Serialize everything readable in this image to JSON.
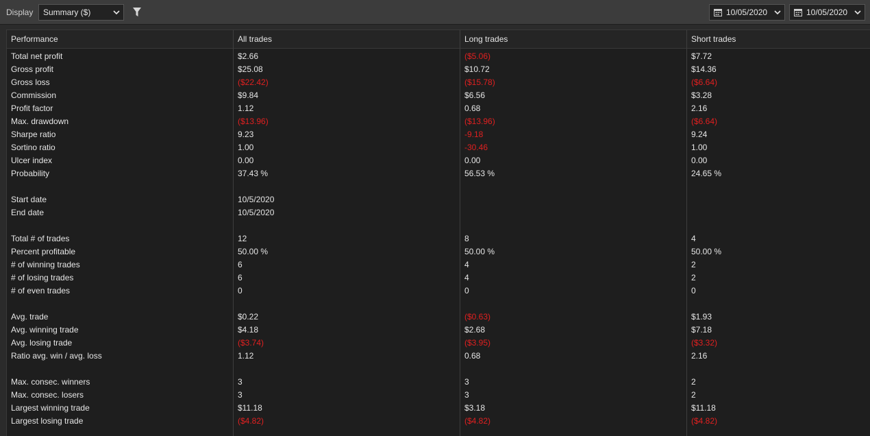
{
  "toolbar": {
    "display_label": "Display",
    "display_select": "Summary ($)",
    "from_date": "10/05/2020",
    "to_date": "10/05/2020"
  },
  "colors": {
    "negative": "#e02020",
    "text": "#e6e6e6",
    "background": "#1e1e1e"
  },
  "table": {
    "columns": [
      "Performance",
      "All trades",
      "Long trades",
      "Short trades"
    ],
    "rows": [
      {
        "label": "Total net profit",
        "all": "$2.66",
        "long": "($5.06)",
        "short": "$7.72",
        "neg": [
          false,
          true,
          false
        ]
      },
      {
        "label": "Gross profit",
        "all": "$25.08",
        "long": "$10.72",
        "short": "$14.36",
        "neg": [
          false,
          false,
          false
        ]
      },
      {
        "label": "Gross loss",
        "all": "($22.42)",
        "long": "($15.78)",
        "short": "($6.64)",
        "neg": [
          true,
          true,
          true
        ]
      },
      {
        "label": "Commission",
        "all": "$9.84",
        "long": "$6.56",
        "short": "$3.28",
        "neg": [
          false,
          false,
          false
        ]
      },
      {
        "label": "Profit factor",
        "all": "1.12",
        "long": "0.68",
        "short": "2.16",
        "neg": [
          false,
          false,
          false
        ]
      },
      {
        "label": "Max. drawdown",
        "all": "($13.96)",
        "long": "($13.96)",
        "short": "($6.64)",
        "neg": [
          true,
          true,
          true
        ]
      },
      {
        "label": "Sharpe ratio",
        "all": "9.23",
        "long": "-9.18",
        "short": "9.24",
        "neg": [
          false,
          true,
          false
        ]
      },
      {
        "label": "Sortino ratio",
        "all": "1.00",
        "long": "-30.46",
        "short": "1.00",
        "neg": [
          false,
          true,
          false
        ]
      },
      {
        "label": "Ulcer index",
        "all": "0.00",
        "long": "0.00",
        "short": "0.00",
        "neg": [
          false,
          false,
          false
        ]
      },
      {
        "label": "Probability",
        "all": "37.43 %",
        "long": "56.53 %",
        "short": "24.65 %",
        "neg": [
          false,
          false,
          false
        ]
      },
      {
        "label": "",
        "all": "",
        "long": "",
        "short": "",
        "neg": [
          false,
          false,
          false
        ]
      },
      {
        "label": "Start date",
        "all": "10/5/2020",
        "long": "",
        "short": "",
        "neg": [
          false,
          false,
          false
        ]
      },
      {
        "label": "End date",
        "all": "10/5/2020",
        "long": "",
        "short": "",
        "neg": [
          false,
          false,
          false
        ]
      },
      {
        "label": "",
        "all": "",
        "long": "",
        "short": "",
        "neg": [
          false,
          false,
          false
        ]
      },
      {
        "label": "Total # of trades",
        "all": "12",
        "long": "8",
        "short": "4",
        "neg": [
          false,
          false,
          false
        ]
      },
      {
        "label": "Percent profitable",
        "all": "50.00 %",
        "long": "50.00 %",
        "short": "50.00 %",
        "neg": [
          false,
          false,
          false
        ]
      },
      {
        "label": "# of winning trades",
        "all": "6",
        "long": "4",
        "short": "2",
        "neg": [
          false,
          false,
          false
        ]
      },
      {
        "label": "# of losing trades",
        "all": "6",
        "long": "4",
        "short": "2",
        "neg": [
          false,
          false,
          false
        ]
      },
      {
        "label": "# of even trades",
        "all": "0",
        "long": "0",
        "short": "0",
        "neg": [
          false,
          false,
          false
        ]
      },
      {
        "label": "",
        "all": "",
        "long": "",
        "short": "",
        "neg": [
          false,
          false,
          false
        ]
      },
      {
        "label": "Avg. trade",
        "all": "$0.22",
        "long": "($0.63)",
        "short": "$1.93",
        "neg": [
          false,
          true,
          false
        ]
      },
      {
        "label": "Avg. winning trade",
        "all": "$4.18",
        "long": "$2.68",
        "short": "$7.18",
        "neg": [
          false,
          false,
          false
        ]
      },
      {
        "label": "Avg. losing trade",
        "all": "($3.74)",
        "long": "($3.95)",
        "short": "($3.32)",
        "neg": [
          true,
          true,
          true
        ]
      },
      {
        "label": "Ratio avg. win / avg. loss",
        "all": "1.12",
        "long": "0.68",
        "short": "2.16",
        "neg": [
          false,
          false,
          false
        ]
      },
      {
        "label": "",
        "all": "",
        "long": "",
        "short": "",
        "neg": [
          false,
          false,
          false
        ]
      },
      {
        "label": "Max. consec. winners",
        "all": "3",
        "long": "3",
        "short": "2",
        "neg": [
          false,
          false,
          false
        ]
      },
      {
        "label": "Max. consec. losers",
        "all": "3",
        "long": "3",
        "short": "2",
        "neg": [
          false,
          false,
          false
        ]
      },
      {
        "label": "Largest winning trade",
        "all": "$11.18",
        "long": "$3.18",
        "short": "$11.18",
        "neg": [
          false,
          false,
          false
        ]
      },
      {
        "label": "Largest losing trade",
        "all": "($4.82)",
        "long": "($4.82)",
        "short": "($4.82)",
        "neg": [
          true,
          true,
          true
        ]
      }
    ]
  }
}
